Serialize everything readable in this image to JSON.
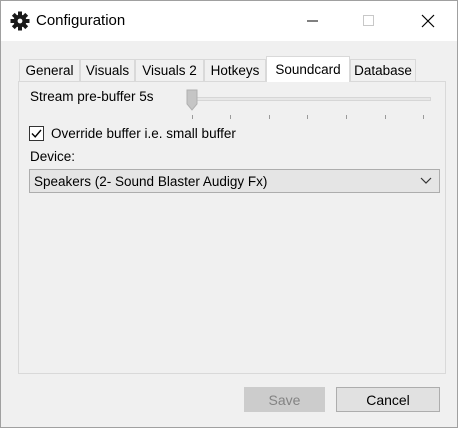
{
  "window": {
    "title": "Configuration",
    "icon": "gear-icon"
  },
  "tabs": [
    {
      "label": "General",
      "active": false
    },
    {
      "label": "Visuals",
      "active": false
    },
    {
      "label": "Visuals 2",
      "active": false
    },
    {
      "label": "Hotkeys",
      "active": false
    },
    {
      "label": "Soundcard",
      "active": true
    },
    {
      "label": "Database",
      "active": false
    }
  ],
  "soundcard": {
    "buffer_label": "Stream pre-buffer 5s",
    "buffer_slider_value": 0,
    "override_label": "Override buffer i.e. small buffer",
    "override_checked": true,
    "device_label": "Device:",
    "device_selected": "Speakers (2- Sound Blaster Audigy Fx)"
  },
  "footer": {
    "save_label": "Save",
    "save_enabled": false,
    "cancel_label": "Cancel"
  }
}
